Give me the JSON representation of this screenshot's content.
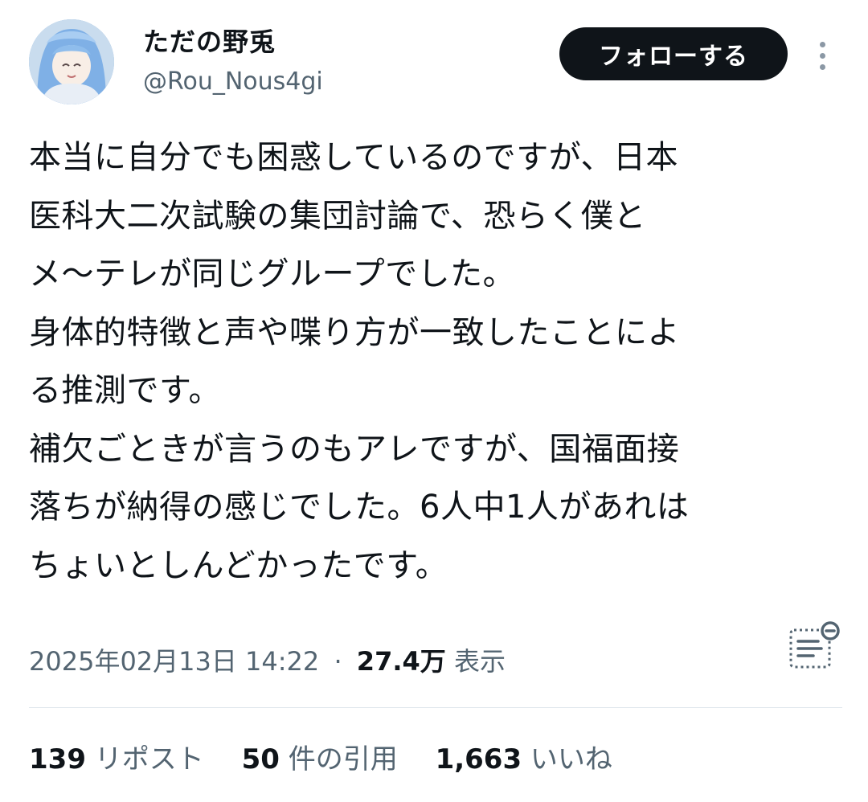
{
  "user": {
    "display_name": "ただの野兎",
    "handle": "@Rou_Nous4gi",
    "avatar_icon": "anime-avatar-icon"
  },
  "follow_button_label": "フォローする",
  "more_icon": "more-vertical-icon",
  "tweet": {
    "lines": [
      "本当に自分でも困惑しているのですが、日本",
      "医科大二次試験の集団討論で、恐らく僕と",
      "メ〜テレが同じグループでした。",
      "身体的特徴と声や喋り方が一致したことによ",
      "る推測です。",
      "補欠ごときが言うのもアレですが、国福面接",
      "落ちが納得の感じでした。6人中1人があれは",
      "ちょいとしんどかったです。"
    ]
  },
  "meta": {
    "timestamp": "2025年02月13日 14:22",
    "separator": "·",
    "views_count": "27.4万",
    "views_label": "表示"
  },
  "analytics_icon": "analytics-icon",
  "stats": {
    "reposts_count": "139",
    "reposts_label": "リポスト",
    "quotes_count": "50",
    "quotes_label": "件の引用",
    "likes_count": "1,663",
    "likes_label": "いいね"
  },
  "colors": {
    "text": "#0f1419",
    "secondary": "#536471",
    "button_bg": "#0f1419",
    "divider": "#e1e8ed"
  }
}
